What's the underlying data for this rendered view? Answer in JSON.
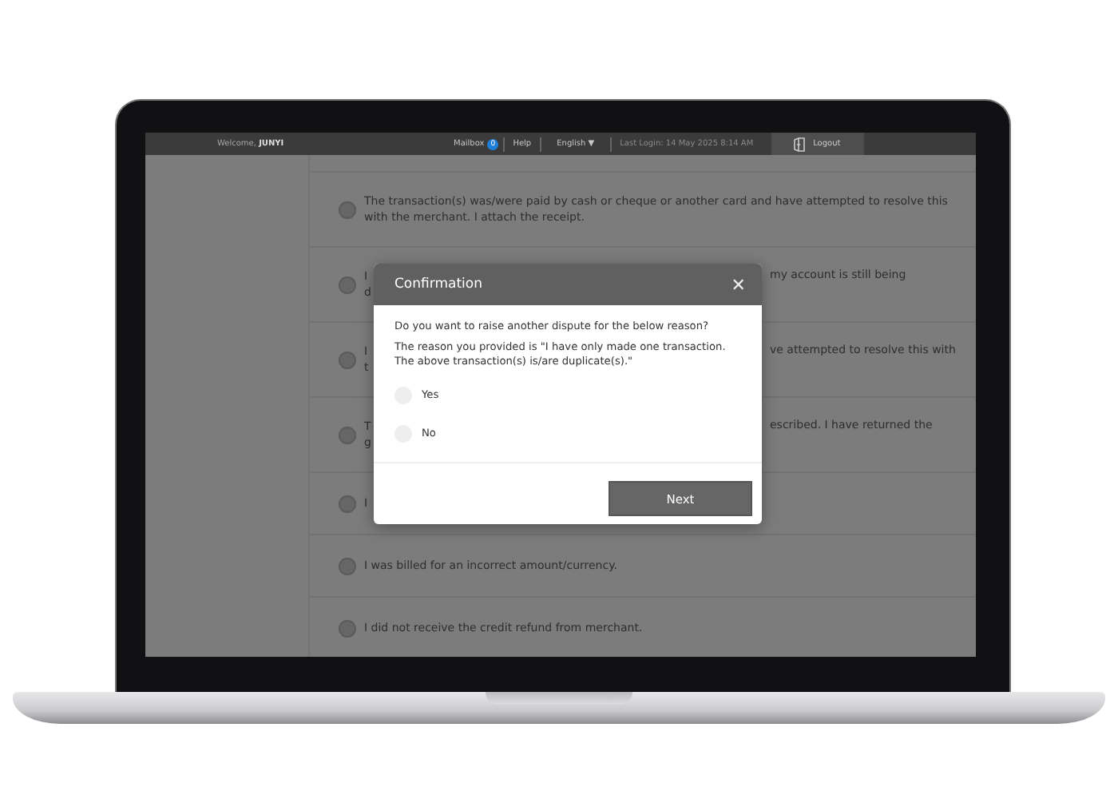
{
  "top_bar": {
    "welcome": "Welcome,",
    "user": "JUNYI",
    "mailbox": "Mailbox",
    "mailbox_count": "0",
    "help": "Help",
    "language": "English",
    "language_caret": "▼",
    "last_login": "Last Login: 14 May 2025 8:14 AM",
    "logout": "Logout"
  },
  "reasons": [
    {
      "selected": false,
      "left_lines": [
        "The transaction(s) was/were paid by cash or cheque or another card and have attempted to resolve this",
        "with the merchant. I attach the receipt."
      ]
    },
    {
      "selected": false,
      "left_lines": [
        "I",
        "d"
      ],
      "right_lines": [
        "my account is still being"
      ]
    },
    {
      "selected": false,
      "left_lines": [
        "I",
        "t"
      ],
      "right_lines": [
        "ve attempted to resolve this with"
      ]
    },
    {
      "selected": false,
      "left_lines": [
        "T",
        "g"
      ],
      "right_lines": [
        "escribed. I have returned the"
      ]
    },
    {
      "selected": false,
      "left_lines": [
        "I"
      ]
    },
    {
      "selected": false,
      "left_lines": [
        "I was billed for an incorrect amount/currency."
      ]
    },
    {
      "selected": false,
      "left_lines": [
        "I did not receive the credit refund from merchant."
      ]
    }
  ],
  "dialog": {
    "title": "Confirmation",
    "close": "✕",
    "question": "Do you want to raise another dispute for the below reason?",
    "reason": "The reason you provided is \"I have only made one transaction. The above transaction(s) is/are duplicate(s).\"",
    "options": [
      {
        "label": "Yes",
        "selected": false
      },
      {
        "label": "No",
        "selected": false
      }
    ],
    "button": "Next"
  }
}
